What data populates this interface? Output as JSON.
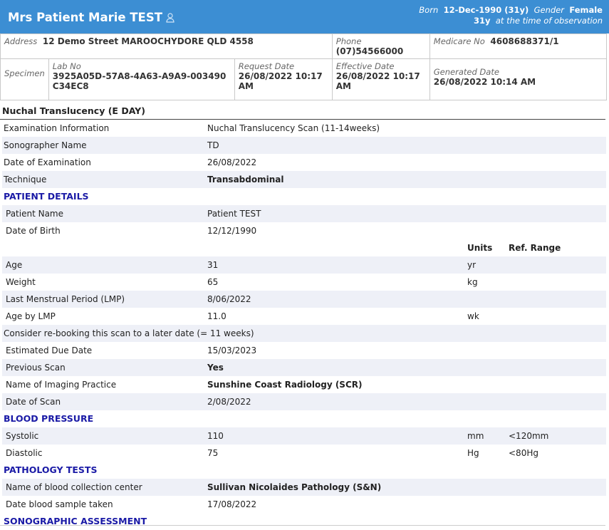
{
  "header": {
    "patient_name": "Mrs Patient Marie TEST",
    "born_label": "Born",
    "born_value": "12-Dec-1990 (31y)",
    "gender_label": "Gender",
    "gender_value": "Female",
    "age_value": "31y",
    "age_note": "at the time of observation"
  },
  "info": {
    "address_label": "Address",
    "address": "12 Demo Street MAROOCHYDORE QLD 4558",
    "phone_label": "Phone",
    "phone": "(07)54566000",
    "medicare_label": "Medicare No",
    "medicare": "4608688371/1",
    "specimen_label": "Specimen",
    "labno_label": "Lab No",
    "labno": "3925A05D-57A8-4A63-A9A9-003490C34EC8",
    "request_label": "Request Date",
    "request": "26/08/2022 10:17 AM",
    "effective_label": "Effective Date",
    "effective": "26/08/2022 10:17 AM",
    "generated_label": "Generated Date",
    "generated": "26/08/2022 10:14 AM"
  },
  "report": {
    "title": "Nuchal Translucency (E DAY)",
    "exam_label": "Examination Information",
    "exam": "Nuchal Translucency Scan (11-14weeks)",
    "sono_label": "Sonographer Name",
    "sono": "TD",
    "date_label": "Date of Examination",
    "date": "26/08/2022",
    "tech_label": "Technique",
    "tech": "Transabdominal",
    "sec_patient": "PATIENT DETAILS",
    "pname_label": "Patient Name",
    "pname": "Patient TEST",
    "dob_label": "Date of Birth",
    "dob": "12/12/1990",
    "units_hdr": "Units",
    "ref_hdr": "Ref. Range",
    "age_label": "Age",
    "age": "31",
    "age_unit": "yr",
    "weight_label": "Weight",
    "weight": "65",
    "weight_unit": "kg",
    "lmp_label": "Last Menstrual Period (LMP)",
    "lmp": "8/06/2022",
    "agelmp_label": "Age by LMP",
    "agelmp": "11.0",
    "agelmp_unit": "wk",
    "note": "Consider re-booking this scan to a later date (= 11 weeks)",
    "edd_label": "Estimated Due Date",
    "edd": "15/03/2023",
    "prev_label": "Previous Scan",
    "prev": "Yes",
    "practice_label": "Name of Imaging Practice",
    "practice": "Sunshine Coast Radiology (SCR)",
    "scan_label": "Date of Scan",
    "scan": "2/08/2022",
    "sec_bp": "BLOOD PRESSURE",
    "sys_label": "Systolic",
    "sys": "110",
    "sys_unit": "mm",
    "sys_ref": "<120mm",
    "dia_label": "Diastolic",
    "dia": "75",
    "dia_unit": "Hg",
    "dia_ref": "<80Hg",
    "sec_path": "PATHOLOGY TESTS",
    "coll_label": "Name of blood collection center",
    "coll": "Sullivan Nicolaides Pathology (S&N)",
    "blood_label": "Date blood sample taken",
    "blood": "17/08/2022",
    "sec_sono": "SONOGRAPHIC ASSESSMENT"
  }
}
